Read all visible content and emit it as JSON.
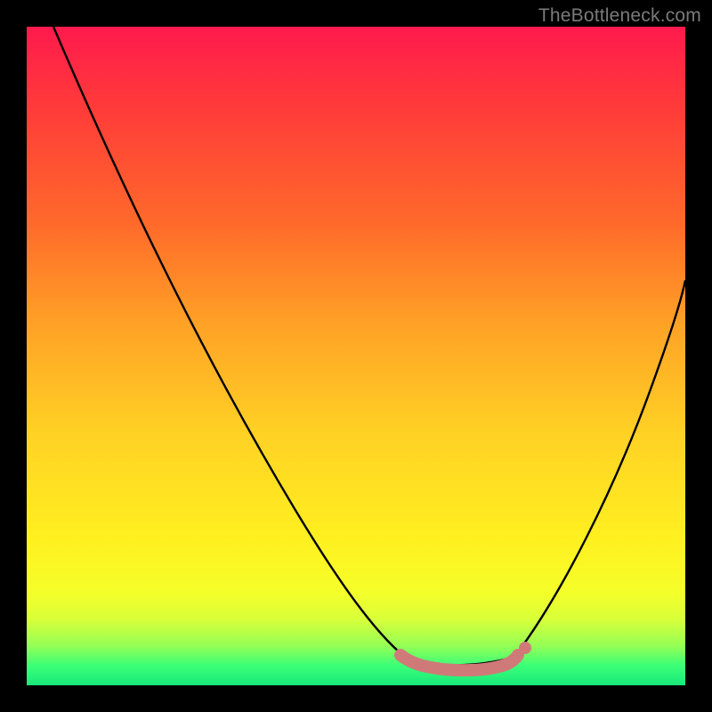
{
  "watermark": "TheBottleneck.com",
  "colors": {
    "frame": "#000000",
    "curve_stroke": "#000000",
    "flat_segment": "#cf7a78",
    "flat_segment_dot": "#cf7a78",
    "gradient_stops": [
      "#ff1a4d",
      "#ff3a3a",
      "#ff6a2a",
      "#ffa126",
      "#ffd224",
      "#fff020",
      "#f4ff2a",
      "#d8ff3a",
      "#95ff55",
      "#3cff78",
      "#18e87a"
    ]
  },
  "chart_data": {
    "type": "line",
    "title": "",
    "xlabel": "",
    "ylabel": "",
    "xlim": [
      0,
      100
    ],
    "ylim": [
      0,
      100
    ],
    "note": "Axes are unlabeled in the source image; x and y are normalized 0–100 from the 740×740 plot area (x left→right, y bottom→top). Values are visually estimated.",
    "series": [
      {
        "name": "left-descending-curve",
        "x": [
          4,
          10,
          20,
          30,
          40,
          50,
          55,
          58
        ],
        "y": [
          100,
          85,
          65,
          47,
          31,
          15,
          7,
          4
        ]
      },
      {
        "name": "flat-bottom-segment",
        "x": [
          58,
          62,
          68,
          72,
          74
        ],
        "y": [
          4,
          3,
          3,
          3,
          4
        ]
      },
      {
        "name": "right-ascending-curve",
        "x": [
          74,
          80,
          86,
          92,
          98,
          100
        ],
        "y": [
          4,
          12,
          26,
          42,
          58,
          62
        ]
      }
    ],
    "highlight": {
      "name": "pink-flat-segment",
      "description": "Thick salmon/pink stroke overlaid on the valley floor with a small dot on the right end.",
      "x_range": [
        57,
        75
      ],
      "y": 3,
      "right_dot": {
        "x": 75,
        "y": 5
      }
    }
  }
}
